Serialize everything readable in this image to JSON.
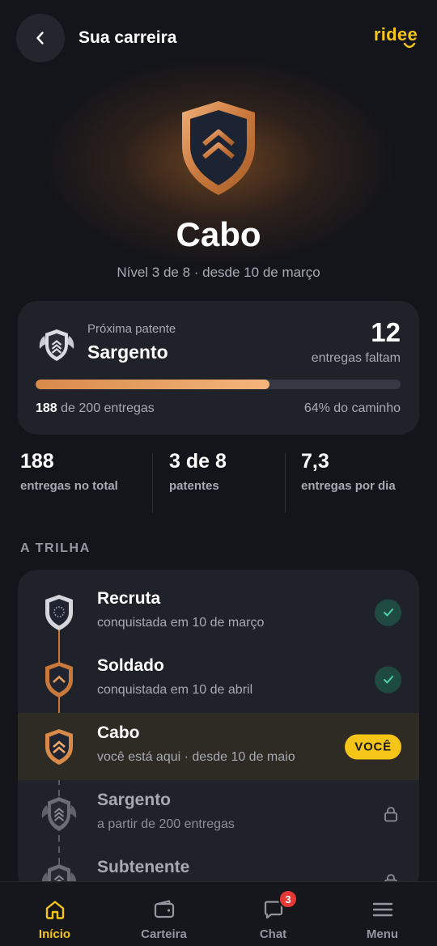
{
  "header": {
    "title": "Sua carreira",
    "logo": "ridee",
    "back_icon": "chevron-left-icon"
  },
  "hero": {
    "rank": "Cabo",
    "subtitle": "Nível 3 de 8 · desde 10 de março",
    "icon": "shield-chevron-icon"
  },
  "next_rank": {
    "label": "Próxima patente",
    "name": "Sargento",
    "remaining": "12",
    "remaining_label": "entregas faltam",
    "progress_fraction": 0.64,
    "count_current": "188",
    "count_rest": " de 200 entregas",
    "percent_text": "64% do caminho"
  },
  "stats": [
    {
      "value": "188",
      "label": "entregas no total"
    },
    {
      "value": "3 de 8",
      "label": "patentes"
    },
    {
      "value": "7,3",
      "label": "entregas por dia"
    }
  ],
  "trail": {
    "title": "A TRILHA",
    "items": [
      {
        "name": "Recruta",
        "desc": "conquistada em 10 de março",
        "status": "done"
      },
      {
        "name": "Soldado",
        "desc": "conquistada em 10 de abril",
        "status": "done"
      },
      {
        "name": "Cabo",
        "desc": "você está aqui · desde 10 de maio",
        "status": "current",
        "badge": "VOCÊ"
      },
      {
        "name": "Sargento",
        "desc": "a partir de 200 entregas",
        "status": "locked"
      },
      {
        "name": "Subtenente",
        "desc": "",
        "status": "locked"
      }
    ]
  },
  "nav": {
    "items": [
      {
        "label": "Início",
        "icon": "home-icon",
        "active": true
      },
      {
        "label": "Carteira",
        "icon": "wallet-icon"
      },
      {
        "label": "Chat",
        "icon": "chat-icon",
        "badge": "3"
      },
      {
        "label": "Menu",
        "icon": "menu-icon"
      }
    ]
  },
  "colors": {
    "accent": "#f5c518",
    "bronze": "#d88a4a",
    "success": "#2fbf8f",
    "background": "#14151a"
  }
}
